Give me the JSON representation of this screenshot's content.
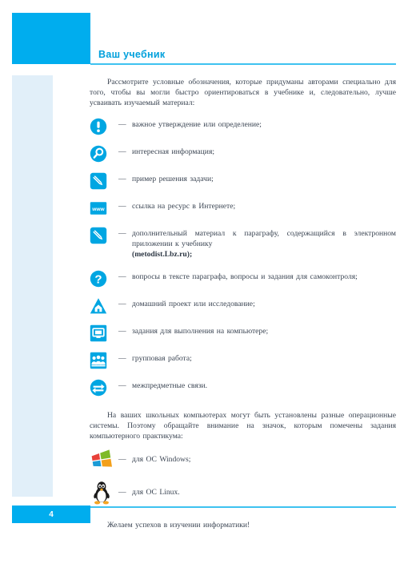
{
  "page": {
    "title": "Ваш учебник",
    "number": "4",
    "accent_color": "#00ADEE",
    "rule_color": "#3FC2F0",
    "margin_tint_color": "#E1EFF9",
    "text_color": "#3C4654"
  },
  "intro_paragraph": "Рассмотрите условные обозначения, которые придуманы авторами специально для того, чтобы вы могли быстро ориентироваться в учебнике и, следовательно, лучше усваивать изучаемый материал:",
  "legend": {
    "dash": "—",
    "items": [
      {
        "icon": "exclamation-circle-icon",
        "text": "важное утверждение или определение;"
      },
      {
        "icon": "magnifier-circle-icon",
        "text": "интересная информация;"
      },
      {
        "icon": "pencil-square-icon",
        "text": "пример решения задачи;"
      },
      {
        "icon": "www-square-icon",
        "text": "ссылка на ресурс в Интернете;"
      },
      {
        "icon": "pencil-supplement-icon",
        "text": "дополнительный материал к параграфу, содержащийся в электронном приложении к учебнику",
        "bold_suffix": "(metodist.Lbz.ru);"
      },
      {
        "icon": "question-circle-icon",
        "text": "вопросы в тексте параграфа, вопросы и задания для самоконтроля;"
      },
      {
        "icon": "home-triangle-icon",
        "text": "домашний проект или исследование;"
      },
      {
        "icon": "monitor-square-icon",
        "text": "задания для выполнения на компьютере;"
      },
      {
        "icon": "group-people-square-icon",
        "text": "групповая работа;"
      },
      {
        "icon": "two-arrows-circle-icon",
        "text": "межпредметные связи."
      }
    ]
  },
  "os_paragraph": "На ваших школьных компьютерах могут быть установлены разные операционные системы. Поэтому обращайте внимание на значок, которым помечены задания компьютерного практикума:",
  "os_list": {
    "dash": "—",
    "items": [
      {
        "icon": "windows-logo-icon",
        "text": "для ОС Windows;"
      },
      {
        "icon": "linux-tux-logo-icon",
        "text": "для ОС Linux."
      }
    ]
  },
  "closing_line": "Желаем успехов в изучении информатики!"
}
